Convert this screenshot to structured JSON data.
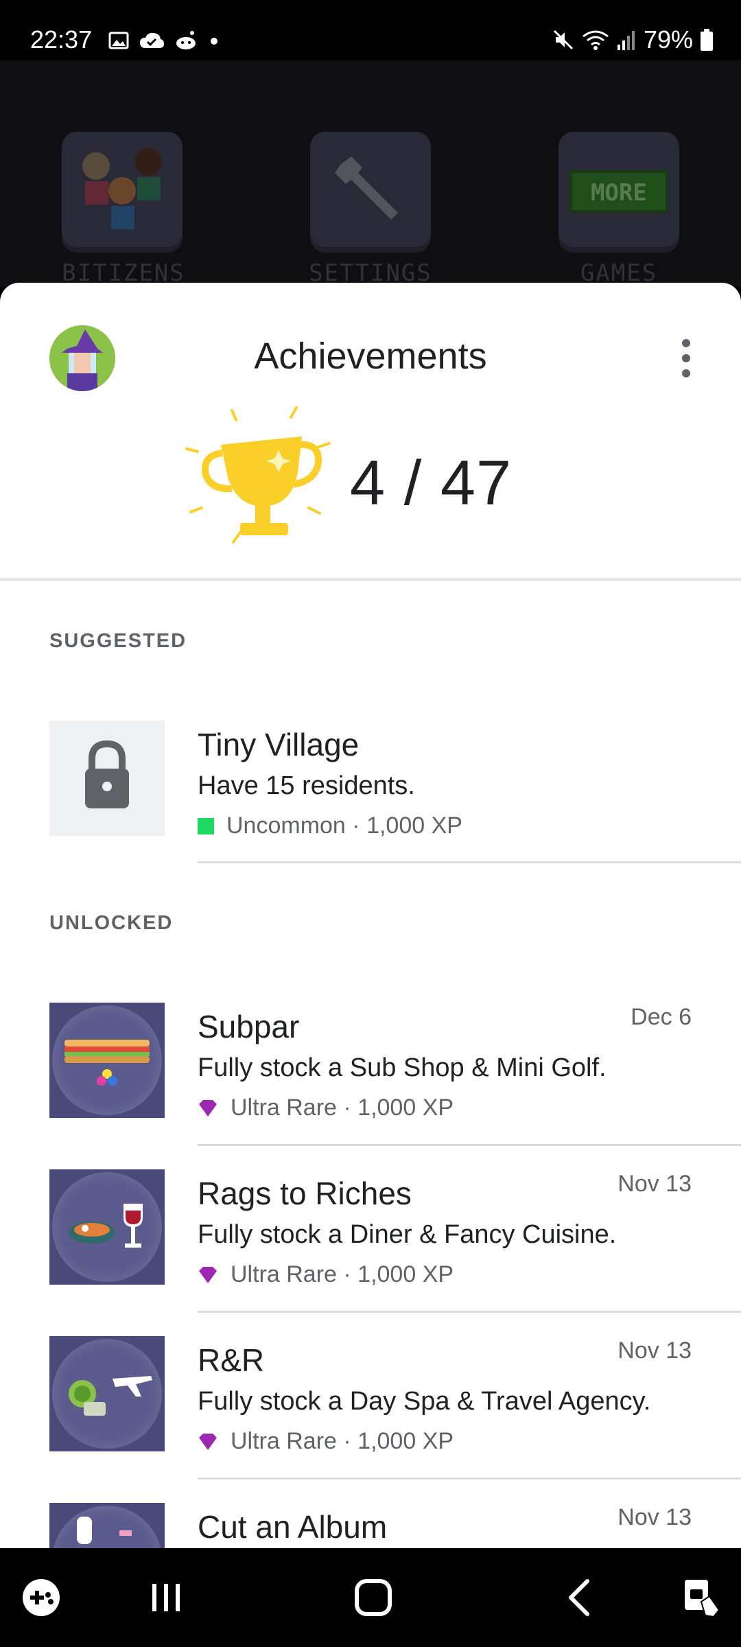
{
  "status_bar": {
    "time": "22:37",
    "battery": "79%"
  },
  "game_background": {
    "tiles": [
      "BITIZENS",
      "SETTINGS",
      "GAMES"
    ],
    "more_badge": "MORE"
  },
  "header": {
    "title": "Achievements",
    "score": "4 / 47",
    "colors": {
      "trophy": "#fbcf2a"
    }
  },
  "sections": {
    "suggested_label": "SUGGESTED",
    "unlocked_label": "UNLOCKED"
  },
  "suggested": [
    {
      "title": "Tiny Village",
      "description": "Have 15 residents.",
      "rarity": "Uncommon",
      "xp": "1,000 XP",
      "rarity_color": "#1ed760",
      "icon": "lock-icon"
    }
  ],
  "unlocked": [
    {
      "title": "Subpar",
      "description": "Fully stock a Sub Shop & Mini Golf.",
      "rarity": "Ultra Rare",
      "xp": "1,000 XP",
      "date": "Dec 6",
      "rarity_color": "#9c27b0"
    },
    {
      "title": "Rags to Riches",
      "description": "Fully stock a Diner & Fancy Cuisine.",
      "rarity": "Ultra Rare",
      "xp": "1,000 XP",
      "date": "Nov 13",
      "rarity_color": "#9c27b0"
    },
    {
      "title": "R&R",
      "description": "Fully stock a Day Spa & Travel Agency.",
      "rarity": "Ultra Rare",
      "xp": "1,000 XP",
      "date": "Nov 13",
      "rarity_color": "#9c27b0"
    },
    {
      "title": "Cut an Album",
      "date": "Nov 13"
    }
  ],
  "meta_separator": "·"
}
